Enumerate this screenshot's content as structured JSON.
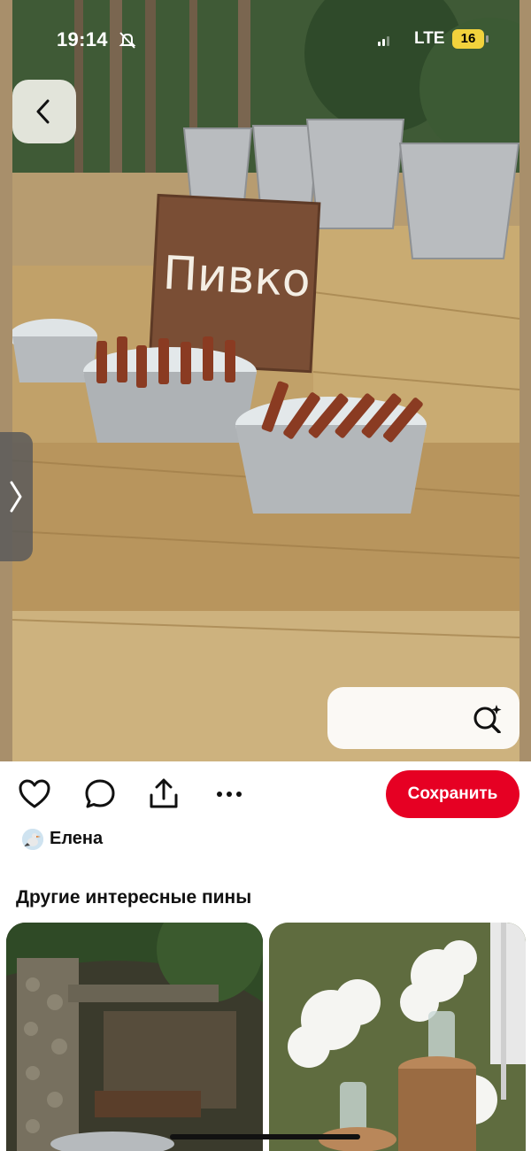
{
  "status_bar": {
    "time": "19:14",
    "network": "LTE",
    "battery": "16"
  },
  "pin": {
    "sign_text": "Пивко",
    "author_name": "Елена"
  },
  "actions": {
    "save_label": "Сохранить",
    "icons": [
      "heart-icon",
      "comment-icon",
      "share-icon",
      "more-icon"
    ]
  },
  "more_pins": {
    "title": "Другие интересные пины"
  },
  "colors": {
    "accent": "#e60023",
    "battery": "#f2d23c"
  }
}
